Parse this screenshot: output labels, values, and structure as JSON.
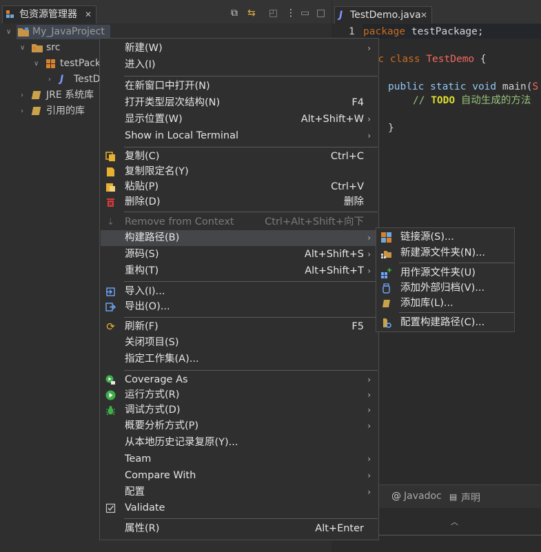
{
  "explorer": {
    "tab_title": "包资源管理器",
    "close_glyph": "✕",
    "tree": [
      {
        "label": "My_JavaProject"
      },
      {
        "label": "src"
      },
      {
        "label": "testPack"
      },
      {
        "label": "TestD"
      },
      {
        "label": "JRE 系统库"
      },
      {
        "label": "引用的库"
      }
    ]
  },
  "editor": {
    "tab_title": "TestDemo.java",
    "line_number": "1",
    "code": {
      "l1_kw": "package",
      "l1_rest": " testPackage;",
      "l3_kw": "lic class",
      "l3_cls": "TestDemo",
      "l3_rest": " {",
      "l5_kw": "public static void",
      "l5_rest": " main(",
      "l5_cls": "S",
      "l6_slashes": "// ",
      "l6_todo": "TODO",
      "l6_rest": " 自动生成的方法",
      "l8": "}"
    },
    "bottom_tabs": [
      "Javadoc",
      "声明"
    ],
    "bottom_at": "@"
  },
  "context_menu": {
    "items": [
      {
        "label": "新建(W)",
        "shortcut": "",
        "submenu": true
      },
      {
        "label": "进入(I)",
        "shortcut": "",
        "submenu": false
      },
      {
        "label": "在新窗口中打开(N)",
        "shortcut": "",
        "submenu": false
      },
      {
        "label": "打开类型层次结构(N)",
        "shortcut": "F4",
        "submenu": false
      },
      {
        "label": "显示位置(W)",
        "shortcut": "Alt+Shift+W",
        "submenu": true
      },
      {
        "label": "Show in Local Terminal",
        "shortcut": "",
        "submenu": true
      },
      {
        "label": "复制(C)",
        "shortcut": "Ctrl+C",
        "submenu": false
      },
      {
        "label": "复制限定名(Y)",
        "shortcut": "",
        "submenu": false
      },
      {
        "label": "粘贴(P)",
        "shortcut": "Ctrl+V",
        "submenu": false
      },
      {
        "label": "删除(D)",
        "shortcut": "删除",
        "submenu": false
      },
      {
        "label": "Remove from Context",
        "shortcut": "Ctrl+Alt+Shift+向下",
        "submenu": false,
        "disabled": true
      },
      {
        "label": "构建路径(B)",
        "shortcut": "",
        "submenu": true,
        "highlighted": true
      },
      {
        "label": "源码(S)",
        "shortcut": "Alt+Shift+S",
        "submenu": true
      },
      {
        "label": "重构(T)",
        "shortcut": "Alt+Shift+T",
        "submenu": true
      },
      {
        "label": "导入(I)...",
        "shortcut": "",
        "submenu": false
      },
      {
        "label": "导出(O)...",
        "shortcut": "",
        "submenu": false
      },
      {
        "label": "刷新(F)",
        "shortcut": "F5",
        "submenu": false
      },
      {
        "label": "关闭项目(S)",
        "shortcut": "",
        "submenu": false
      },
      {
        "label": "指定工作集(A)...",
        "shortcut": "",
        "submenu": false
      },
      {
        "label": "Coverage As",
        "shortcut": "",
        "submenu": true
      },
      {
        "label": "运行方式(R)",
        "shortcut": "",
        "submenu": true
      },
      {
        "label": "调试方式(D)",
        "shortcut": "",
        "submenu": true
      },
      {
        "label": "概要分析方式(P)",
        "shortcut": "",
        "submenu": true
      },
      {
        "label": "从本地历史记录复原(Y)...",
        "shortcut": "",
        "submenu": false
      },
      {
        "label": "Team",
        "shortcut": "",
        "submenu": true
      },
      {
        "label": "Compare With",
        "shortcut": "",
        "submenu": true
      },
      {
        "label": "配置",
        "shortcut": "",
        "submenu": true
      },
      {
        "label": "Validate",
        "shortcut": "",
        "submenu": false
      },
      {
        "label": "属性(R)",
        "shortcut": "Alt+Enter",
        "submenu": false
      }
    ],
    "arrow_glyph": "›"
  },
  "build_path_submenu": {
    "items": [
      {
        "label": "链接源(S)..."
      },
      {
        "label": "新建源文件夹(N)..."
      },
      {
        "label": "用作源文件夹(U)"
      },
      {
        "label": "添加外部归档(V)..."
      },
      {
        "label": "添加库(L)..."
      },
      {
        "label": "配置构建路径(C)..."
      }
    ]
  },
  "colors": {
    "menu_bg": "#2f2f2f",
    "highlight": "#444649",
    "keyword": "#cc6c1d",
    "class_name": "#f26a5f",
    "comment": "#98c379",
    "todo": "#dcdf2c"
  }
}
